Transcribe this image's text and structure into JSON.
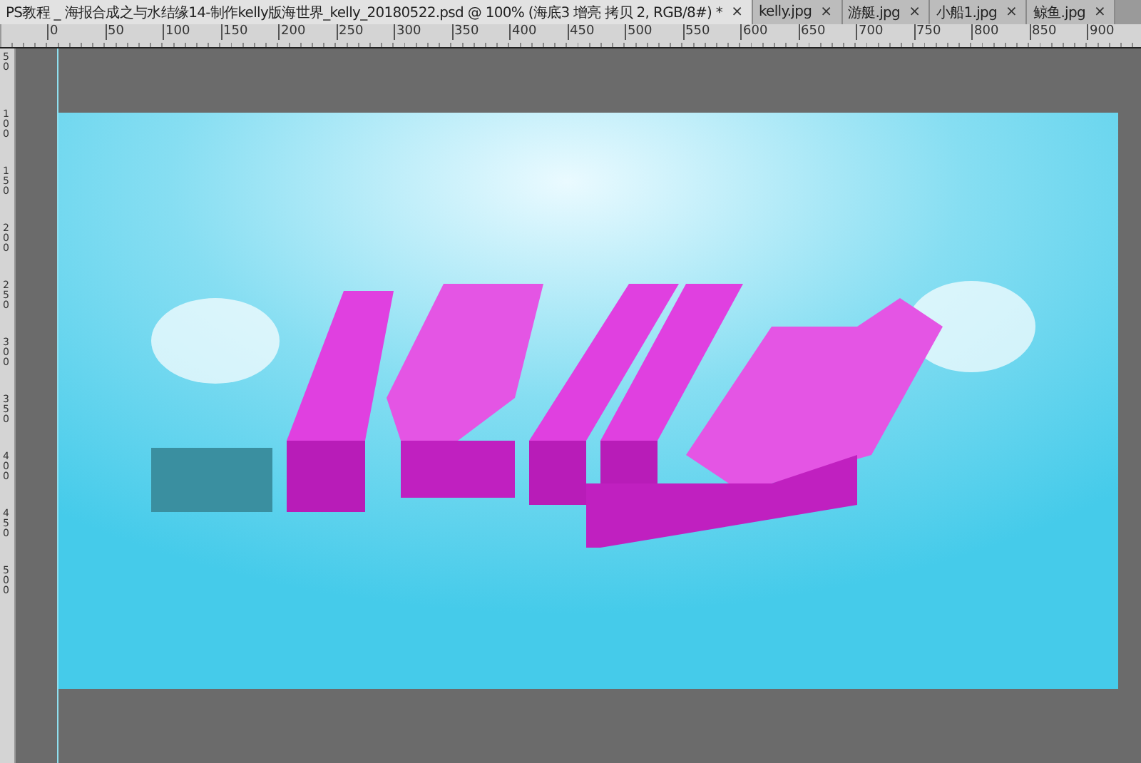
{
  "tabs": [
    {
      "label": "PS教程 _ 海报合成之与水结缘14-制作kelly版海世界_kelly_20180522.psd @ 100% (海底3 增亮 拷贝 2, RGB/8#) *",
      "close": "×",
      "selected": true
    },
    {
      "label": "kelly.jpg",
      "close": "×",
      "selected": false
    },
    {
      "label": "游艇.jpg",
      "close": "×",
      "selected": false
    },
    {
      "label": "小船1.jpg",
      "close": "×",
      "selected": false
    },
    {
      "label": "鲸鱼.jpg",
      "close": "×",
      "selected": false
    }
  ],
  "ruler_top": {
    "labels": [
      "0",
      "50",
      "100",
      "150",
      "200",
      "250",
      "300",
      "350",
      "400",
      "450",
      "500",
      "550",
      "600",
      "650",
      "700",
      "750",
      "800",
      "850",
      "900"
    ]
  },
  "ruler_left": {
    "labels": [
      "50",
      "100",
      "150",
      "200",
      "250",
      "300",
      "350",
      "400",
      "450",
      "500"
    ]
  }
}
